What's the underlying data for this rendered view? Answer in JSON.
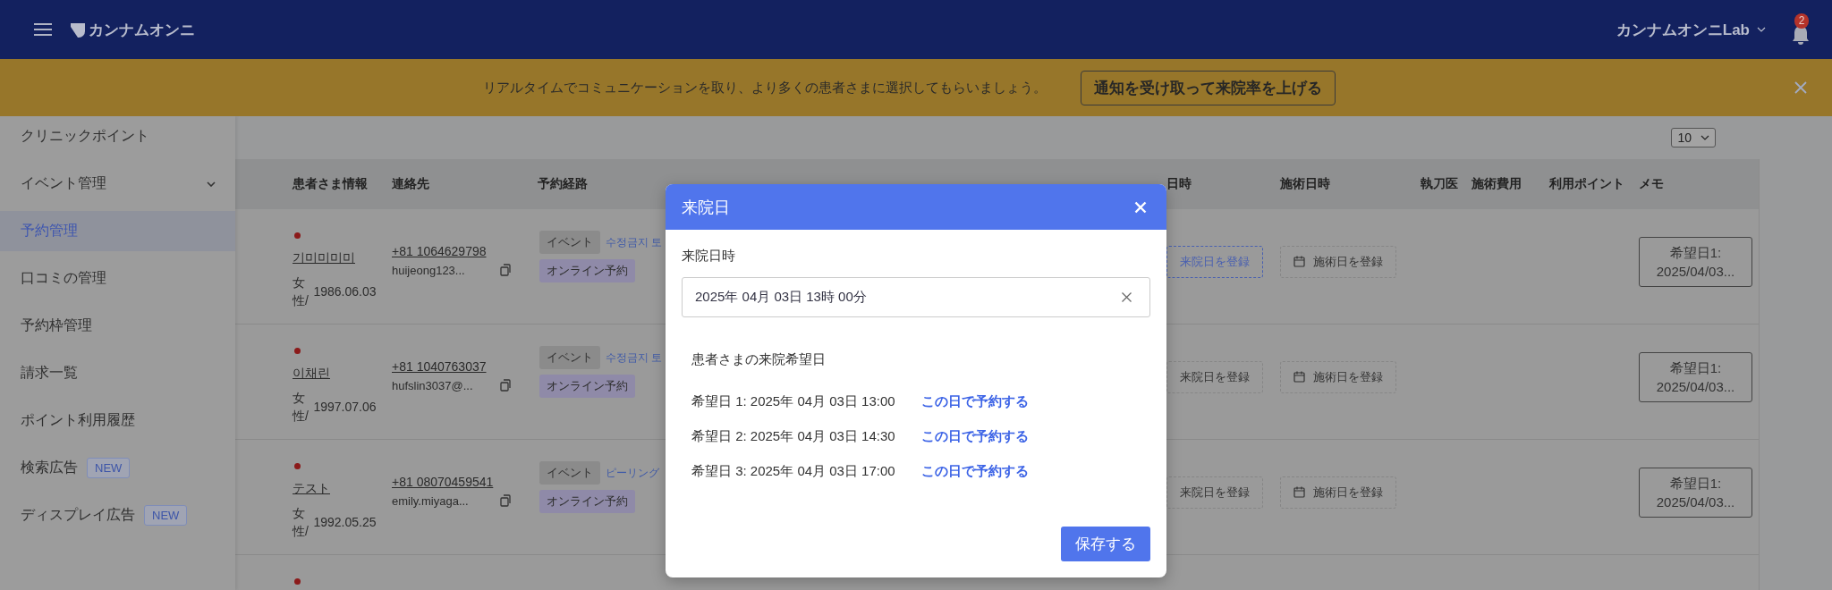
{
  "header": {
    "logo_text": "カンナムオンニ",
    "account": "カンナムオンニLab",
    "notification_count": "2"
  },
  "banner": {
    "message": "リアルタイムでコミュニケーションを取り、より多くの患者さまに選択してもらいましょう。",
    "button": "通知を受け取って来院率を上げる"
  },
  "sidebar": {
    "items": [
      {
        "label": "クリニックポイント",
        "kind": "link",
        "selected": false
      },
      {
        "label": "イベント管理",
        "kind": "group",
        "expanded": false,
        "selected": false
      },
      {
        "label": "予約管理",
        "kind": "link",
        "selected": true
      },
      {
        "label": "口コミの管理",
        "kind": "link",
        "selected": false
      },
      {
        "label": "予約枠管理",
        "kind": "link",
        "selected": false
      },
      {
        "label": "請求一覧",
        "kind": "link",
        "selected": false
      },
      {
        "label": "ポイント利用履歴",
        "kind": "link",
        "selected": false
      },
      {
        "label": "検索広告",
        "kind": "link",
        "selected": false,
        "badge": "NEW"
      },
      {
        "label": "ディスプレイ広告",
        "kind": "link",
        "selected": false,
        "badge": "NEW"
      }
    ]
  },
  "page_size": "10",
  "table": {
    "columns": [
      "患者さま情報",
      "連絡先",
      "予約経路",
      "日時",
      "施術日時",
      "執刀医",
      "施術費用",
      "利用ポイント",
      "メモ"
    ],
    "rows": [
      {
        "unread": true,
        "name": "기미미미미",
        "gender": "女性/",
        "birthdate": "1986.06.03",
        "phone": "+81 1064629798",
        "email": "huijeong123...",
        "route_tag": "イベント",
        "route_link": "수정금지 토",
        "booking_type": "オンライン予約",
        "visit_button": "来院日を登録",
        "visit_focused": true,
        "treatment_button": "施術日を登録",
        "memo": "希望日1: 2025/04/03..."
      },
      {
        "unread": true,
        "name": "이채린",
        "gender": "女性/",
        "birthdate": "1997.07.06",
        "phone": "+81 1040763037",
        "email": "hufslin3037@...",
        "route_tag": "イベント",
        "route_link": "수정금지 토",
        "booking_type": "オンライン予約",
        "visit_button": "来院日を登録",
        "visit_focused": false,
        "treatment_button": "施術日を登録",
        "memo": "希望日1: 2025/04/03..."
      },
      {
        "unread": true,
        "name": "テスト",
        "gender": "女性/",
        "birthdate": "1992.05.25",
        "phone": "+81 08070459541",
        "email": "emily.miyaga...",
        "route_tag": "イベント",
        "route_link": "ピーリング",
        "booking_type": "オンライン予約",
        "visit_button": "来院日を登録",
        "visit_focused": false,
        "treatment_button": "施術日を登録",
        "memo": "希望日1: 2025/04/03..."
      },
      {
        "unread": true
      }
    ]
  },
  "dialog": {
    "title": "来院日",
    "field_label": "来院日時",
    "value": "2025年 04月 03日 13時 00分",
    "preferred_heading": "患者さまの来院希望日",
    "preferred": [
      {
        "text": "希望日 1: 2025年 04月 03日 13:00",
        "link": "この日で予約する"
      },
      {
        "text": "希望日 2: 2025年 04月 03日 14:30",
        "link": "この日で予約する"
      },
      {
        "text": "希望日 3: 2025年 04月 03日 17:00",
        "link": "この日で予約する"
      }
    ],
    "save": "保存する"
  }
}
